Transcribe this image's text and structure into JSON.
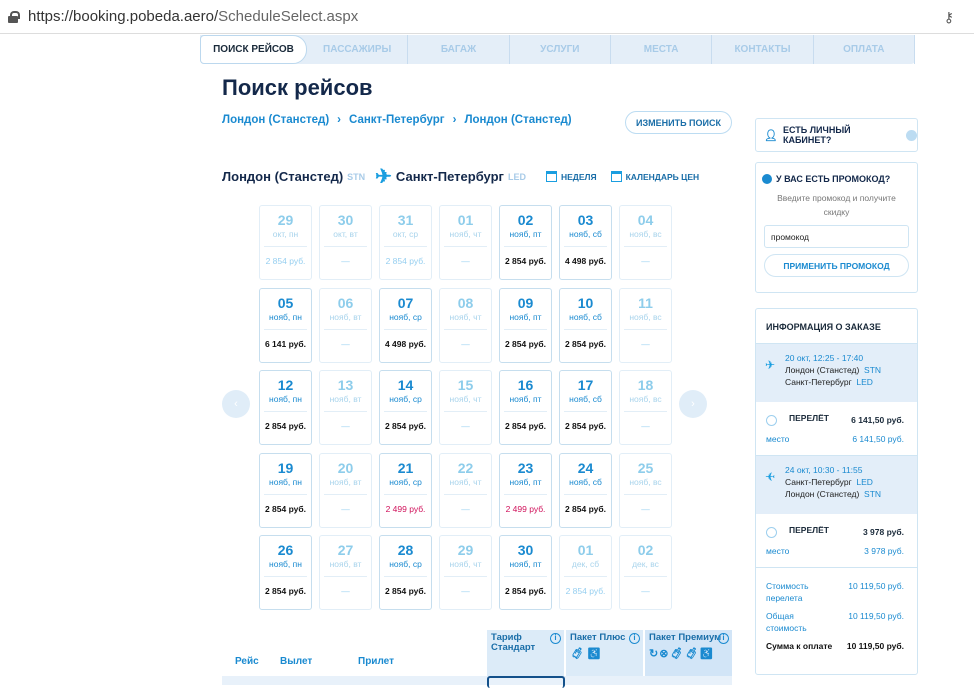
{
  "browser": {
    "url_host": "https://booking.pobeda.aero/",
    "url_path": "ScheduleSelect.aspx",
    "key_icon": "key-icon"
  },
  "steps": [
    "ПОИСК РЕЙСОВ",
    "ПАССАЖИРЫ",
    "БАГАЖ",
    "УСЛУГИ",
    "МЕСТА",
    "КОНТАКТЫ",
    "ОПЛАТА"
  ],
  "title": "Поиск рейсов",
  "breadcrumb": [
    "Лондон (Станстед)",
    "Санкт-Петербург",
    "Лондон (Станстед)"
  ],
  "change_search": "ИЗМЕНИТЬ ПОИСК",
  "route": {
    "from": "Лондон (Станстед)",
    "from_code": "STN",
    "to": "Санкт-Петербург",
    "to_code": "LED",
    "week": "НЕДЕЛЯ",
    "price_calendar": "КАЛЕНДАРЬ ЦЕН"
  },
  "calendar": [
    [
      {
        "d": "29",
        "m": "окт, пн",
        "p": "2 854 руб.",
        "on": false
      },
      {
        "d": "30",
        "m": "окт, вт",
        "p": "—",
        "on": false
      },
      {
        "d": "31",
        "m": "окт, ср",
        "p": "2 854 руб.",
        "on": false
      },
      {
        "d": "01",
        "m": "нояб, чт",
        "p": "—",
        "on": false
      },
      {
        "d": "02",
        "m": "нояб, пт",
        "p": "2 854 руб.",
        "on": true
      },
      {
        "d": "03",
        "m": "нояб, сб",
        "p": "4 498 руб.",
        "on": true
      },
      {
        "d": "04",
        "m": "нояб, вс",
        "p": "—",
        "on": false
      }
    ],
    [
      {
        "d": "05",
        "m": "нояб, пн",
        "p": "6 141 руб.",
        "on": true
      },
      {
        "d": "06",
        "m": "нояб, вт",
        "p": "—",
        "on": false
      },
      {
        "d": "07",
        "m": "нояб, ср",
        "p": "4 498 руб.",
        "on": true
      },
      {
        "d": "08",
        "m": "нояб, чт",
        "p": "—",
        "on": false
      },
      {
        "d": "09",
        "m": "нояб, пт",
        "p": "2 854 руб.",
        "on": true
      },
      {
        "d": "10",
        "m": "нояб, сб",
        "p": "2 854 руб.",
        "on": true
      },
      {
        "d": "11",
        "m": "нояб, вс",
        "p": "—",
        "on": false
      }
    ],
    [
      {
        "d": "12",
        "m": "нояб, пн",
        "p": "2 854 руб.",
        "on": true
      },
      {
        "d": "13",
        "m": "нояб, вт",
        "p": "—",
        "on": false
      },
      {
        "d": "14",
        "m": "нояб, ср",
        "p": "2 854 руб.",
        "on": true
      },
      {
        "d": "15",
        "m": "нояб, чт",
        "p": "—",
        "on": false
      },
      {
        "d": "16",
        "m": "нояб, пт",
        "p": "2 854 руб.",
        "on": true
      },
      {
        "d": "17",
        "m": "нояб, сб",
        "p": "2 854 руб.",
        "on": true
      },
      {
        "d": "18",
        "m": "нояб, вс",
        "p": "—",
        "on": false
      }
    ],
    [
      {
        "d": "19",
        "m": "нояб, пн",
        "p": "2 854 руб.",
        "on": true
      },
      {
        "d": "20",
        "m": "нояб, вт",
        "p": "—",
        "on": false
      },
      {
        "d": "21",
        "m": "нояб, ср",
        "p": "2 499 руб.",
        "on": true,
        "red": true
      },
      {
        "d": "22",
        "m": "нояб, чт",
        "p": "—",
        "on": false
      },
      {
        "d": "23",
        "m": "нояб, пт",
        "p": "2 499 руб.",
        "on": true,
        "red": true
      },
      {
        "d": "24",
        "m": "нояб, сб",
        "p": "2 854 руб.",
        "on": true
      },
      {
        "d": "25",
        "m": "нояб, вс",
        "p": "—",
        "on": false
      }
    ],
    [
      {
        "d": "26",
        "m": "нояб, пн",
        "p": "2 854 руб.",
        "on": true
      },
      {
        "d": "27",
        "m": "нояб, вт",
        "p": "—",
        "on": false
      },
      {
        "d": "28",
        "m": "нояб, ср",
        "p": "2 854 руб.",
        "on": true
      },
      {
        "d": "29",
        "m": "нояб, чт",
        "p": "—",
        "on": false
      },
      {
        "d": "30",
        "m": "нояб, пт",
        "p": "2 854 руб.",
        "on": true
      },
      {
        "d": "01",
        "m": "дек, сб",
        "p": "2 854 руб.",
        "on": false
      },
      {
        "d": "02",
        "m": "дек, вс",
        "p": "—",
        "on": false
      }
    ]
  ],
  "account": {
    "label": "ЕСТЬ ЛИЧНЫЙ КАБИНЕТ?"
  },
  "promo": {
    "title": "У ВАС ЕСТЬ ПРОМОКОД?",
    "subtitle": "Введите промокод и получите скидку",
    "value": "промокод",
    "apply": "ПРИМЕНИТЬ ПРОМОКОД"
  },
  "order": {
    "title": "ИНФОРМАЦИЯ О ЗАКАЗЕ",
    "segments": [
      {
        "date": "20 окт, 12:25 - 17:40",
        "from": "Лондон (Станстед)",
        "from_code": "STN",
        "to": "Санкт-Петербург",
        "to_code": "LED",
        "flight_label": "ПЕРЕЛЁТ",
        "flight_price": "6 141,50 руб.",
        "seat_label": "место",
        "seat_price": "6 141,50 руб."
      },
      {
        "date": "24 окт, 10:30 - 11:55",
        "from": "Санкт-Петербург",
        "from_code": "LED",
        "to": "Лондон (Станстед)",
        "to_code": "STN",
        "flight_label": "ПЕРЕЛЁТ",
        "flight_price": "3 978 руб.",
        "seat_label": "место",
        "seat_price": "3 978 руб."
      }
    ],
    "totals": [
      {
        "label": "Стоимость перелета",
        "value": "10 119,50 руб."
      },
      {
        "label": "Общая стоимость",
        "value": "10 119,50 руб."
      },
      {
        "label": "Сумма к оплате",
        "value": "10 119,50 руб."
      }
    ]
  },
  "table": {
    "cols": [
      "Рейс",
      "Вылет",
      "Прилет"
    ],
    "tariffs": [
      "Тариф Стандарт",
      "Пакет Плюс",
      "Пакет Премиум"
    ]
  }
}
